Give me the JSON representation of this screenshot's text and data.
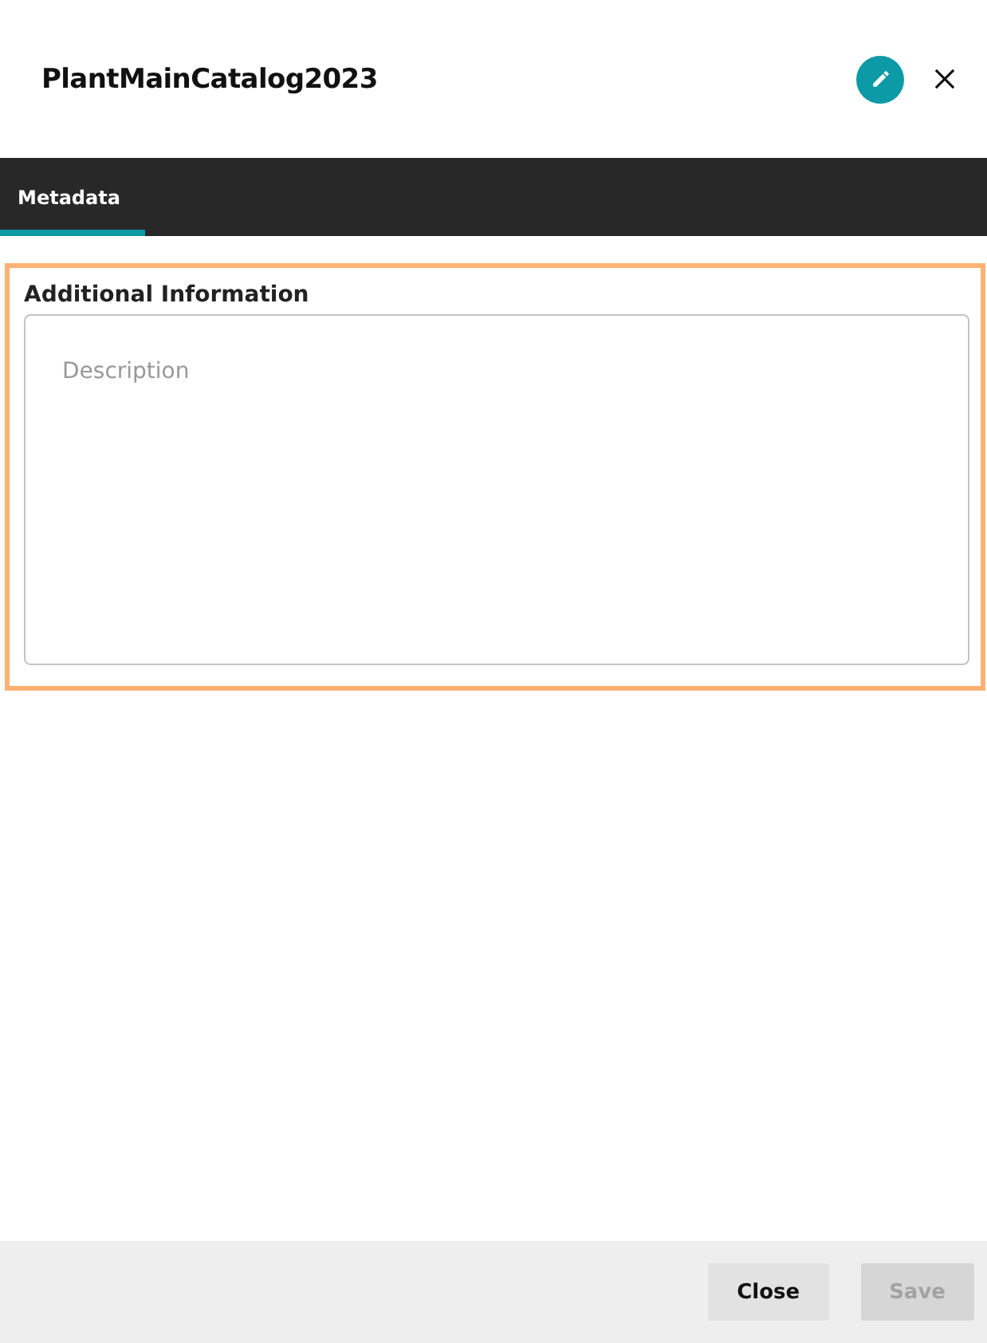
{
  "dialog": {
    "title": "PlantMainCatalog2023"
  },
  "tabs": [
    {
      "label": "Metadata",
      "selected": true
    }
  ],
  "section": {
    "title": "Additional Information",
    "highlighted": true,
    "description": {
      "placeholder": "Description"
    }
  },
  "buttons": [
    {
      "label": "Close",
      "disabled": false
    },
    {
      "label": "Save",
      "disabled": true
    }
  ]
}
